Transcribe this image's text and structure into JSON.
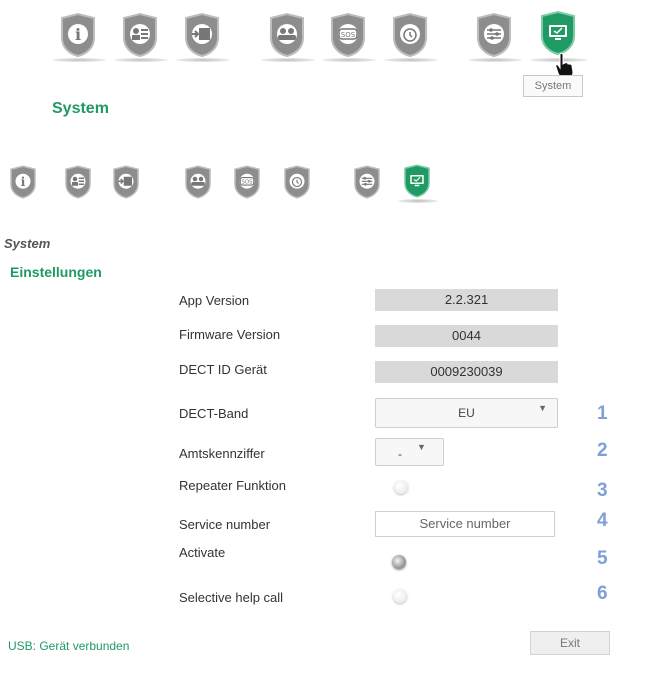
{
  "toolbar": {
    "icons": [
      "info-icon",
      "contact-card-icon",
      "card-exit-icon",
      "users-icon",
      "sos-icon",
      "alarm-clock-icon",
      "settings-sliders-icon",
      "system-monitor-icon"
    ],
    "tooltip": "System",
    "active_icon": "system-monitor-icon"
  },
  "header": {
    "title": "System"
  },
  "section": {
    "title": "System",
    "subtitle": "Einstellungen"
  },
  "fields": {
    "app_version": {
      "label": "App Version",
      "value": "2.2.321"
    },
    "firmware_version": {
      "label": "Firmware Version",
      "value": "0044"
    },
    "dect_id": {
      "label": "DECT ID Gerät",
      "value": "0009230039"
    },
    "dect_band": {
      "label": "DECT-Band",
      "value": "EU"
    },
    "amtskennziffer": {
      "label": "Amtskennziffer",
      "value": "-"
    },
    "repeater": {
      "label": "Repeater Funktion"
    },
    "service_number": {
      "label": "Service number",
      "placeholder": "Service number"
    },
    "activate": {
      "label": "Activate"
    },
    "selective_help": {
      "label": "Selective help call"
    }
  },
  "annotations": [
    "1",
    "2",
    "3",
    "4",
    "5",
    "6"
  ],
  "footer": {
    "usb_status": "USB: Gerät verbunden",
    "exit_label": "Exit"
  },
  "colors": {
    "accent": "#1f9a64",
    "shield_gray": "#8a8a8a",
    "annotation": "#7f9fd6"
  }
}
